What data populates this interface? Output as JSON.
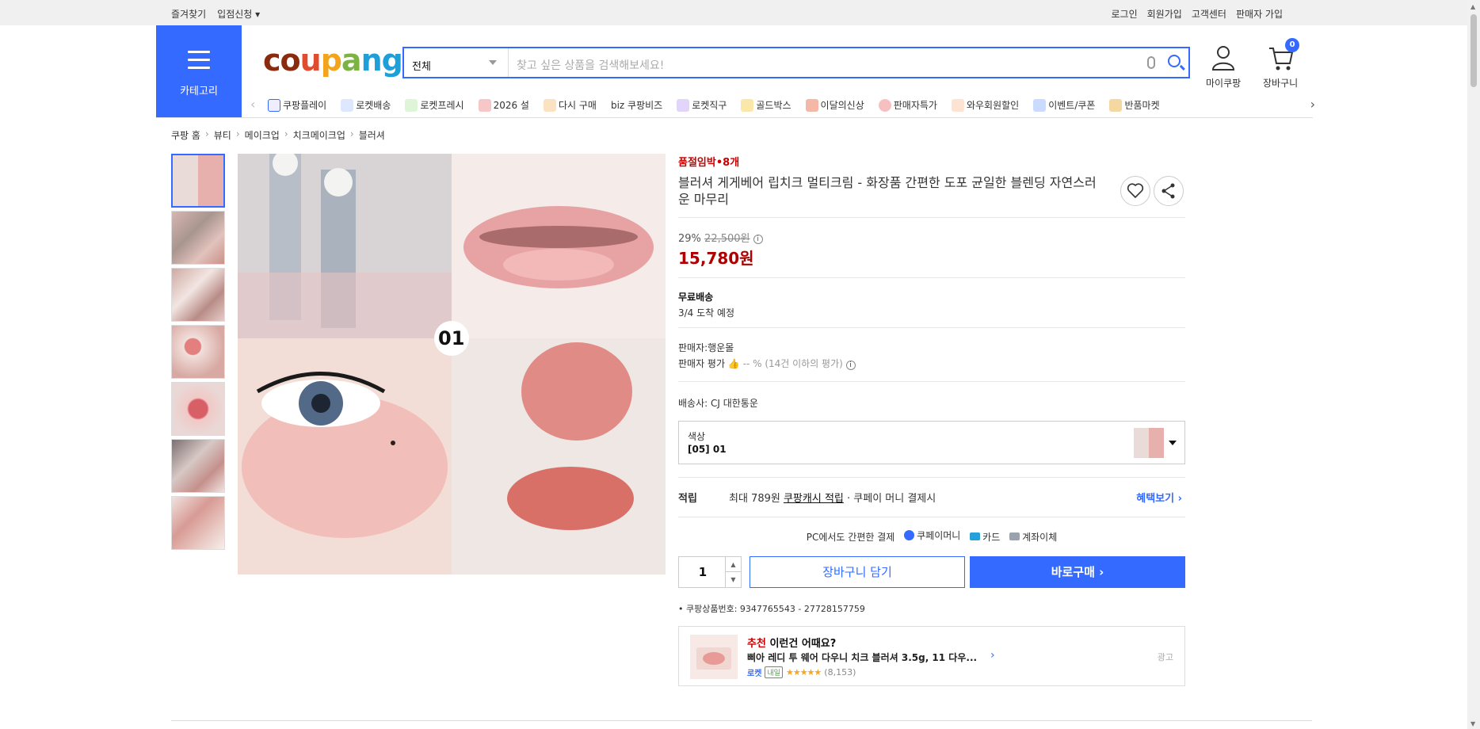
{
  "topbar": {
    "left": [
      "즐겨찾기",
      "입점신청 ▾"
    ],
    "right": [
      "로그인",
      "회원가입",
      "고객센터",
      "판매자 가입"
    ]
  },
  "header": {
    "category_label": "카테고리",
    "logo_text": "coupang",
    "search": {
      "category": "전체",
      "placeholder": "찾고 싶은 상품을 검색해보세요!"
    },
    "mycoupang": "마이쿠팡",
    "cart": "장바구니",
    "cart_count": "0"
  },
  "catnav": [
    "쿠팡플레이",
    "로켓배송",
    "로켓프레시",
    "2026 설",
    "다시 구매",
    "biz 쿠팡비즈",
    "로켓직구",
    "골드박스",
    "이달의신상",
    "판매자특가",
    "와우회원할인",
    "이벤트/쿠폰",
    "반품마켓"
  ],
  "breadcrumb": [
    "쿠팡 홈",
    "뷰티",
    "메이크업",
    "치크메이크업",
    "블러셔"
  ],
  "product": {
    "stock_note": "품절임박•8개",
    "title": "블러셔 게게베어 립치크 멀티크림 - 화장품 간편한 도포 균일한 블렌딩 자연스러운 마무리",
    "discount": "29%",
    "original_price": "22,500원",
    "sale_price": "15,780원",
    "shipping_title": "무료배송",
    "shipping_eta": "3/4 도착 예정",
    "seller": "판매자:행운몰",
    "seller_rating_label": "판매자 평가",
    "seller_rating_value": "-- % (14건 이하의 평가)",
    "carrier": "배송사:  CJ 대한통운",
    "option_label": "색상",
    "option_value": "[05] 01",
    "reward_label": "적립",
    "reward_text_1": "최대 789원",
    "reward_text_link": "쿠팡캐시 적립",
    "reward_text_2": "· 쿠페이 머니 결제시",
    "reward_benefit": "혜택보기 ›",
    "pay_title": "PC에서도 간편한 결제",
    "pay_methods": [
      "쿠페이머니",
      "카드",
      "계좌이체"
    ],
    "quantity": "1",
    "add_to_cart": "장바구니 담기",
    "buy_now": "바로구매 ›",
    "product_number": "쿠팡상품번호: 9347765543 - 27728157759",
    "main_image_label": "01"
  },
  "recommend": {
    "title_red": "추천",
    "title_rest": " 이런건 어때요?",
    "item_name": "삐아 레디 투 웨어 다우니 치크 블러셔 3.5g, 11 다우...",
    "rocket": "로켓",
    "tomorrow": "내일",
    "stars": "★★★★★",
    "review_count": "(8,153)",
    "ad_label": "광고"
  },
  "colors": {
    "accent": "#346aff",
    "price_red": "#ae0000"
  }
}
